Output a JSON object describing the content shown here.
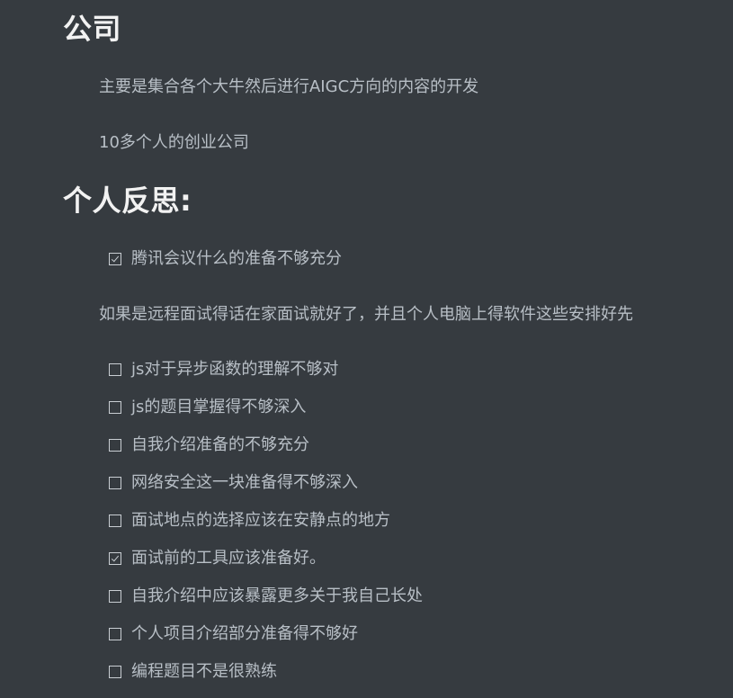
{
  "sections": [
    {
      "title": "公司",
      "paragraphs": [
        "主要是集合各个大牛然后进行AIGC方向的内容的开发",
        "10多个人的创业公司"
      ]
    },
    {
      "title": "个人反思:"
    }
  ],
  "reflection": {
    "first_task": {
      "text": "腾讯会议什么的准备不够充分",
      "checked": true
    },
    "paragraph": "如果是远程面试得话在家面试就好了，并且个人电脑上得软件这些安排好先",
    "tasks": [
      {
        "text": "js对于异步函数的理解不够对",
        "checked": false
      },
      {
        "text": "js的题目掌握得不够深入",
        "checked": false
      },
      {
        "text": "自我介绍准备的不够充分",
        "checked": false
      },
      {
        "text": "网络安全这一块准备得不够深入",
        "checked": false
      },
      {
        "text": "面试地点的选择应该在安静点的地方",
        "checked": false
      },
      {
        "text": "面试前的工具应该准备好。",
        "checked": true
      },
      {
        "text": "自我介绍中应该暴露更多关于我自己长处",
        "checked": false
      },
      {
        "text": "个人项目介绍部分准备得不够好",
        "checked": false
      },
      {
        "text": "编程题目不是很熟练",
        "checked": false
      }
    ]
  },
  "colors": {
    "background": "#363b40",
    "heading": "#f2f2f2",
    "text": "#b8bfc6",
    "checkbox_border": "#c9ced3"
  }
}
